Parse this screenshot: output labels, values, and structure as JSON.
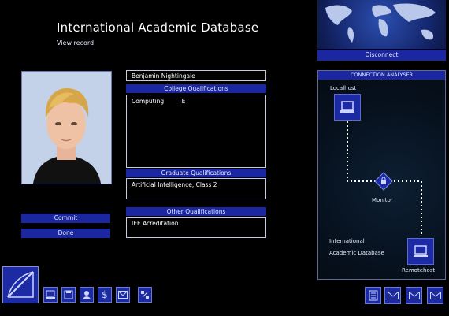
{
  "header": {
    "title": "International Academic Database",
    "subtitle": "View record"
  },
  "record": {
    "name": "Benjamin Nightingale",
    "college_label": "College Qualifications",
    "college_subject": "Computing",
    "college_grade": "E",
    "graduate_label": "Graduate Qualifications",
    "graduate_value": "Artificial Intelligence, Class 2",
    "other_label": "Other Qualifications",
    "other_value": "IEE Acreditation"
  },
  "actions": {
    "commit_label": "Commit",
    "done_label": "Done"
  },
  "connection": {
    "disconnect_label": "Disconnect",
    "analyser_title": "CONNECTION ANALYSER",
    "localhost_label": "Localhost",
    "monitor_label": "Monitor",
    "target_line1": "International",
    "target_line2": "Academic Database",
    "remote_label": "Remotehost"
  },
  "taskbar": {
    "left_icons": [
      "terminal-icon",
      "disk-icon",
      "person-icon",
      "dollar-icon",
      "mail-icon",
      "tools-icon"
    ],
    "right_icons": [
      "document-icon",
      "mail-icon",
      "mail-icon",
      "mail-icon"
    ]
  },
  "colors": {
    "accent": "#1a27a0",
    "background": "#000000",
    "dotted_link": "#ffffff"
  }
}
